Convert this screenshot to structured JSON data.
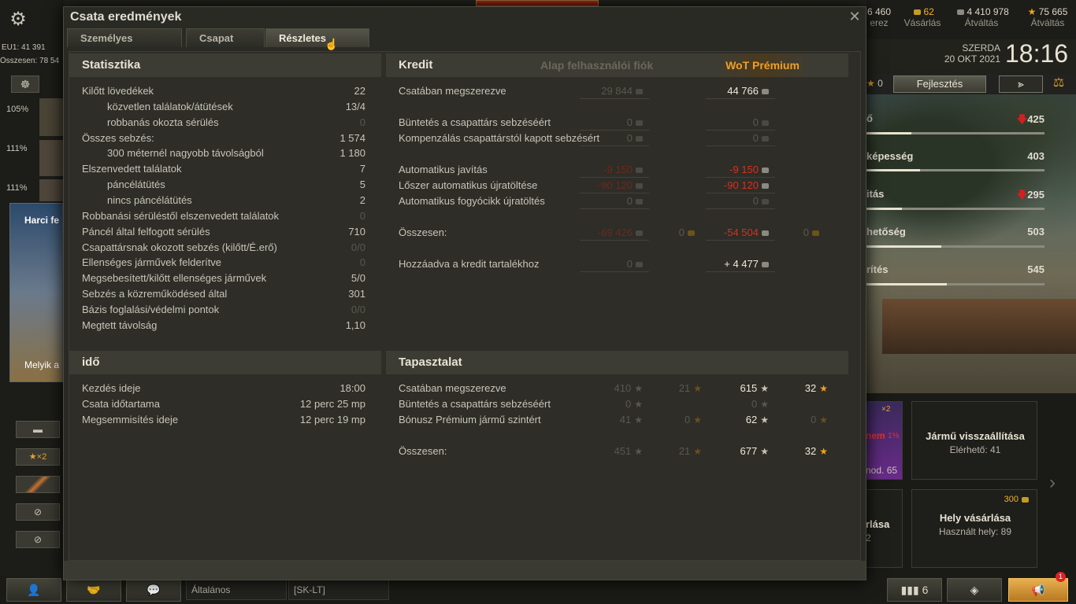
{
  "top": {
    "server": "EU1: 41 391",
    "total": "Összesen: 78 54",
    "resources": [
      {
        "value": "6 460",
        "label": "erez"
      },
      {
        "value": "62",
        "label": "Vásárlás"
      },
      {
        "value": "4 410 978",
        "label": "Átváltás"
      },
      {
        "value": "75 665",
        "label": "Átváltás"
      }
    ],
    "day": "SZERDA",
    "date": "20 OKT 2021",
    "time": "18:16"
  },
  "dialog": {
    "title": "Csata eredmények",
    "tabs": [
      "Személyes eredmény",
      "Csapat pont",
      "Részletes jelentés"
    ],
    "active_tab": 2
  },
  "statistics": {
    "title": "Statisztika",
    "rows": [
      {
        "label": "Kilőtt lövedékek",
        "value": "22"
      },
      {
        "label": "közvetlen találatok/átütések",
        "value": "13/4",
        "indent": true
      },
      {
        "label": "robbanás okozta sérülés",
        "value": "0",
        "indent": true,
        "dim": true
      },
      {
        "label": "Összes sebzés:",
        "value": "1 574"
      },
      {
        "label": "300 méternél nagyobb távolságból",
        "value": "1 180",
        "indent": true
      },
      {
        "label": "Elszenvedett találatok",
        "value": "7"
      },
      {
        "label": "páncélátütés",
        "value": "5",
        "indent": true
      },
      {
        "label": "nincs páncélátütés",
        "value": "2",
        "indent": true
      },
      {
        "label": "Robbanási sérüléstől elszenvedett találatok",
        "value": "0",
        "dim": true
      },
      {
        "label": "Páncél által felfogott sérülés",
        "value": "710"
      },
      {
        "label": "Csapattársnak okozott sebzés (kilőtt/É.erő)",
        "value": "0/0",
        "dim": true
      },
      {
        "label": "Ellenséges járművek felderítve",
        "value": "0",
        "dim": true
      },
      {
        "label": "Megsebesített/kilőtt ellenséges járművek",
        "value": "5/0"
      },
      {
        "label": "Sebzés a közreműködésed által",
        "value": "301"
      },
      {
        "label": "Bázis foglalási/védelmi pontok",
        "value": "0/0",
        "dim": true
      },
      {
        "label": "Megtett távolság",
        "value": "1,10"
      }
    ]
  },
  "credit": {
    "title": "Kredit",
    "col_basic": "Alap felhasználói fiók",
    "col_premium": "WoT Prémium",
    "rows": [
      {
        "label": "Csatában megszerezve",
        "basic": "29 844",
        "premium": "44 766"
      },
      {
        "label": "Büntetés a csapattárs sebzéséért",
        "basic": "0",
        "premium": "0"
      },
      {
        "label": "Kompenzálás csapattárstól kapott sebzésért",
        "basic": "0",
        "premium": "0"
      },
      {
        "label": "Automatikus javítás",
        "basic": "-9 150",
        "premium": "-9 150"
      },
      {
        "label": "Lőszer automatikus újratöltése",
        "basic": "-90 120",
        "premium": "-90 120"
      },
      {
        "label": "Automatikus fogyócikk újratöltés",
        "basic": "0",
        "premium": "0"
      },
      {
        "label": "Összesen:",
        "basic": "-69 426",
        "basic_gold": "0",
        "premium": "-54 504",
        "premium_gold": "0"
      },
      {
        "label": "Hozzáadva a kredit tartalékhoz",
        "basic": "0",
        "premium": "+ 4 477"
      }
    ]
  },
  "time": {
    "title": "idő",
    "rows": [
      {
        "label": "Kezdés ideje",
        "value": "18:00"
      },
      {
        "label": "Csata időtartama",
        "value": "12 perc 25 mp"
      },
      {
        "label": "Megsemmisítés ideje",
        "value": "12 perc 19 mp"
      }
    ]
  },
  "experience": {
    "title": "Tapasztalat",
    "rows": [
      {
        "label": "Csatában megszerezve",
        "b1": "410",
        "b2": "21",
        "p1": "615",
        "p2": "32"
      },
      {
        "label": "Büntetés a csapattárs sebzéséért",
        "b1": "0",
        "p1": "0"
      },
      {
        "label": "Bónusz Prémium jármű szintért",
        "b1": "41",
        "b2": "0",
        "p1": "62",
        "p2": "0"
      },
      {
        "label": "Összesen:",
        "b1": "451",
        "b2": "21",
        "p1": "677",
        "p2": "32"
      }
    ]
  },
  "side": {
    "upgrade": "Fejlesztés",
    "zero": "0",
    "stats": [
      {
        "label": "ő",
        "value": "425",
        "down": true,
        "level": 0.25
      },
      {
        "label": "képesség",
        "value": "403",
        "level": 0.3
      },
      {
        "label": "itás",
        "value": "295",
        "down": true,
        "level": 0.2
      },
      {
        "label": "hetőség",
        "value": "503",
        "level": 0.42
      },
      {
        "label": "rítés",
        "value": "545",
        "level": 0.45
      }
    ],
    "card1_title": "Jármű visszaállítása",
    "card1_sub": "Elérhető: 41",
    "card2_title": "Hely vásárlása",
    "card2_sub": "Használt hely: 89",
    "card2_price": "300",
    "partial_card_a": "nem",
    "partial_card_b": "nod. 65",
    "partial_card_c": "rlása",
    "partial_card_d": "2",
    "x2": "×2",
    "pct": "1%"
  },
  "left": {
    "pcts": [
      "105%",
      "111%",
      "111%"
    ],
    "banner": "Harci fe",
    "banner2": "Melyik a",
    "x2": "×2"
  },
  "bottom": {
    "chat_general": "Általános",
    "chat_sk": "[SK-LT]",
    "count": "6",
    "notif": "1"
  }
}
